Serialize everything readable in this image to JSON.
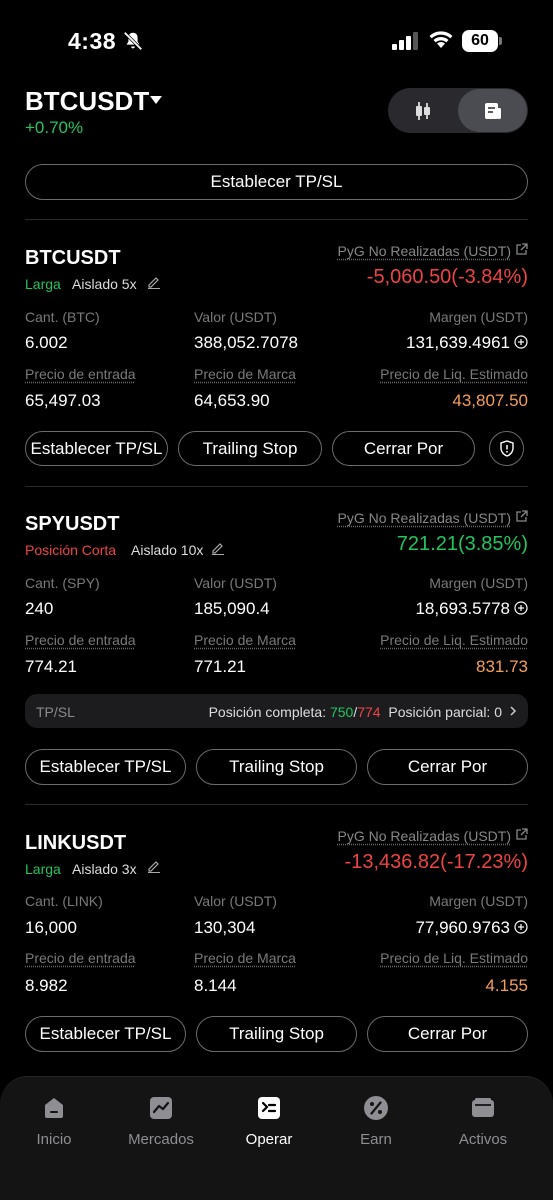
{
  "status_bar": {
    "time": "4:38",
    "battery": "60"
  },
  "header": {
    "pair": "BTCUSDT",
    "change": "+0.70%"
  },
  "global_tpsl_label": "Establecer TP/SL",
  "positions": [
    {
      "symbol": "BTCUSDT",
      "side": "Larga",
      "margin_mode": "Aislado 5x",
      "pnl_label": "PyG No Realizadas (USDT)",
      "pnl_value": "-5,060.50(-3.84%)",
      "qty_label": "Cant. (BTC)",
      "qty": "6.002",
      "value_label": "Valor (USDT)",
      "value": "388,052.7078",
      "margin_label": "Margen (USDT)",
      "margin": "131,639.4961",
      "entry_label": "Precio de entrada",
      "entry": "65,497.03",
      "mark_label": "Precio de Marca",
      "mark": "64,653.90",
      "liq_label": "Precio de Liq. Estimado",
      "liq": "43,807.50",
      "buttons": [
        "Establecer TP/SL",
        "Trailing Stop",
        "Cerrar Por"
      ]
    },
    {
      "symbol": "SPYUSDT",
      "side": "Posición Corta",
      "margin_mode": "Aislado 10x",
      "pnl_label": "PyG No Realizadas (USDT)",
      "pnl_value": "721.21(3.85%)",
      "qty_label": "Cant. (SPY)",
      "qty": "240",
      "value_label": "Valor (USDT)",
      "value": "185,090.4",
      "margin_label": "Margen (USDT)",
      "margin": "18,693.5778",
      "entry_label": "Precio de entrada",
      "entry": "774.21",
      "mark_label": "Precio de Marca",
      "mark": "771.21",
      "liq_label": "Precio de Liq. Estimado",
      "liq": "831.73",
      "tpsl": {
        "label": "TP/SL",
        "full_label": "Posición completa:",
        "tp": "750",
        "sl": "774",
        "partial_label": "Posición parcial: 0"
      },
      "buttons": [
        "Establecer TP/SL",
        "Trailing Stop",
        "Cerrar Por"
      ]
    },
    {
      "symbol": "LINKUSDT",
      "side": "Larga",
      "margin_mode": "Aislado 3x",
      "pnl_label": "PyG No Realizadas (USDT)",
      "pnl_value": "-13,436.82(-17.23%)",
      "qty_label": "Cant. (LINK)",
      "qty": "16,000",
      "value_label": "Valor (USDT)",
      "value": "130,304",
      "margin_label": "Margen (USDT)",
      "margin": "77,960.9763",
      "entry_label": "Precio de entrada",
      "entry": "8.982",
      "mark_label": "Precio de Marca",
      "mark": "8.144",
      "liq_label": "Precio de Liq. Estimado",
      "liq": "4.155",
      "buttons": [
        "Establecer TP/SL",
        "Trailing Stop",
        "Cerrar Por"
      ]
    }
  ],
  "nav": [
    {
      "label": "Inicio",
      "icon": "home-icon"
    },
    {
      "label": "Mercados",
      "icon": "chart-icon"
    },
    {
      "label": "Operar",
      "icon": "trade-icon",
      "active": true
    },
    {
      "label": "Earn",
      "icon": "percent-icon"
    },
    {
      "label": "Activos",
      "icon": "wallet-icon"
    }
  ],
  "colors": {
    "positive": "#22c55e",
    "negative": "#ef4444",
    "liq": "#f59e5a"
  }
}
